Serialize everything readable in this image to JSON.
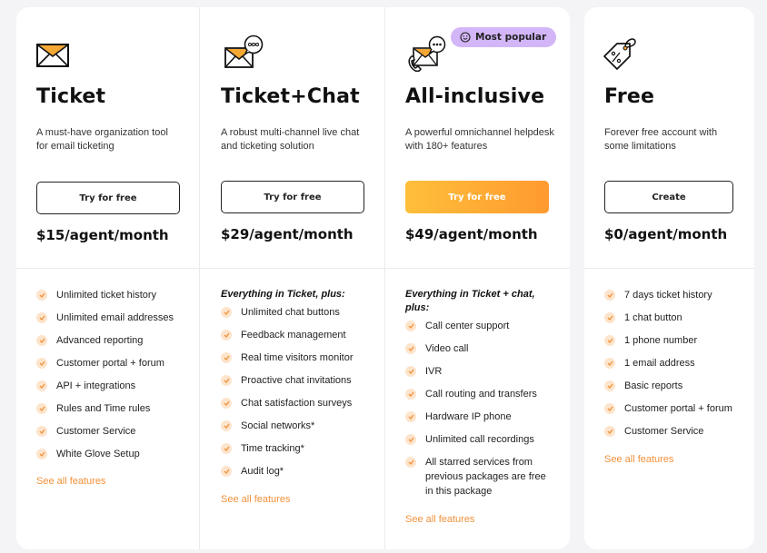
{
  "colors": {
    "page_background": "#f4f4f6",
    "card_background": "#ffffff",
    "accent_orange": "#f0913a",
    "primary_button_gradient_start": "#ffbf3a",
    "primary_button_gradient_end": "#ff9a30",
    "badge_background": "#d3b6f8",
    "check_background": "#fde4cc"
  },
  "plans": [
    {
      "icon": "envelope-icon",
      "name": "Ticket",
      "description": "A must-have organization tool for email ticketing",
      "button_label": "Try for free",
      "price": "$15/agent/month",
      "features_lead": "",
      "features": [
        "Unlimited ticket history",
        "Unlimited email addresses",
        "Advanced reporting",
        "Customer portal + forum",
        "API + integrations",
        "Rules and Time rules",
        "Customer Service",
        "White Glove Setup"
      ],
      "see_all_label": "See all features"
    },
    {
      "icon": "envelope-chat-icon",
      "name": "Ticket+Chat",
      "description": "A robust multi-channel live chat and ticketing solution",
      "button_label": "Try for free",
      "price": "$29/agent/month",
      "features_lead": "Everything in Ticket, plus:",
      "features": [
        "Unlimited chat buttons",
        "Feedback management",
        "Real time visitors monitor",
        "Proactive chat invitations",
        "Chat satisfaction surveys",
        "Social networks*",
        "Time tracking*",
        "Audit log*"
      ],
      "see_all_label": "See all features"
    },
    {
      "icon": "phone-envelope-chat-icon",
      "badge": {
        "icon": "smiley-icon",
        "label": "Most popular"
      },
      "name": "All-inclusive",
      "description": "A powerful omnichannel helpdesk with 180+ features",
      "button_label": "Try for free",
      "price": "$49/agent/month",
      "features_lead": "Everything in Ticket + chat, plus:",
      "features": [
        "Call center support",
        "Video call",
        "IVR",
        "Call routing and transfers",
        "Hardware IP phone",
        "Unlimited call recordings",
        "All starred services from previous packages are free in this package"
      ],
      "see_all_label": "See all features"
    },
    {
      "icon": "price-tag-icon",
      "name": "Free",
      "description": "Forever free account with some limitations",
      "button_label": "Create",
      "price": "$0/agent/month",
      "features_lead": "",
      "features": [
        "7 days ticket history",
        "1 chat button",
        "1 phone number",
        "1 email address",
        "Basic reports",
        "Customer portal + forum",
        "Customer Service"
      ],
      "see_all_label": "See all features"
    }
  ]
}
